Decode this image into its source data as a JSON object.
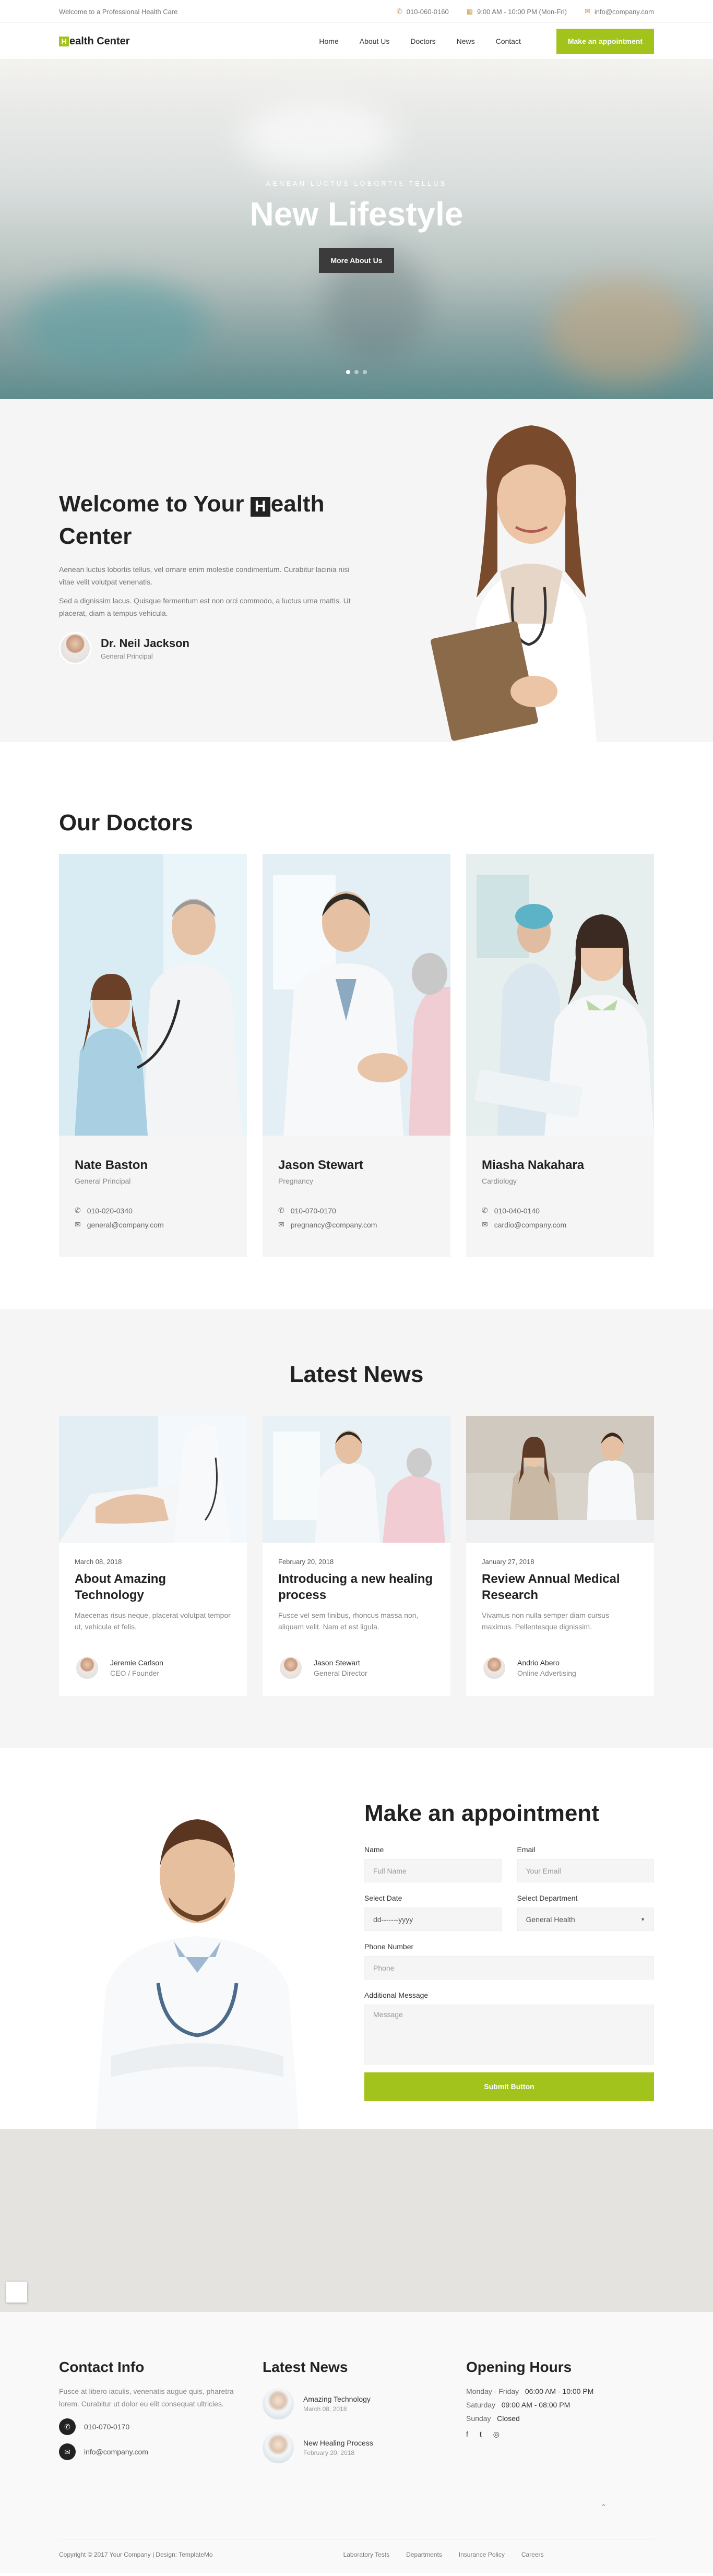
{
  "topbar": {
    "tagline": "Welcome to a Professional Health Care",
    "phone": "010-060-0160",
    "hours": "9:00 AM - 10:00 PM (Mon-Fri)",
    "email": "info@company.com"
  },
  "nav": {
    "logo_mark": "H",
    "logo_text": "ealth Center",
    "links": [
      "Home",
      "About Us",
      "Doctors",
      "News",
      "Contact"
    ],
    "cta": "Make an appointment"
  },
  "hero": {
    "subtitle": "AENEAN LUCTUS LOBORTIS TELLUS",
    "title": "New Lifestyle",
    "button": "More About Us",
    "slide_count": 3,
    "active_slide": 1
  },
  "welcome": {
    "title_before": "Welcome to Your ",
    "title_mark": "H",
    "title_after": "ealth Center",
    "paragraph1": "Aenean luctus lobortis tellus, vel ornare enim molestie condimentum. Curabitur lacinia nisi vitae velit volutpat venenatis.",
    "paragraph2": "Sed a dignissim lacus. Quisque fermentum est non orci commodo, a luctus urna mattis. Ut placerat, diam a tempus vehicula.",
    "author_name": "Dr. Neil Jackson",
    "author_role": "General Principal"
  },
  "doctors": {
    "title": "Our Doctors",
    "items": [
      {
        "name": "Nate Baston",
        "specialty": "General Principal",
        "phone": "010-020-0340",
        "email": "general@company.com"
      },
      {
        "name": "Jason Stewart",
        "specialty": "Pregnancy",
        "phone": "010-070-0170",
        "email": "pregnancy@company.com"
      },
      {
        "name": "Miasha Nakahara",
        "specialty": "Cardiology",
        "phone": "010-040-0140",
        "email": "cardio@company.com"
      }
    ]
  },
  "news": {
    "title": "Latest News",
    "items": [
      {
        "date": "March 08, 2018",
        "title": "About Amazing Technology",
        "text": "Maecenas risus neque, placerat volutpat tempor ut, vehicula et felis.",
        "author": "Jeremie Carlson",
        "role": "CEO / Founder"
      },
      {
        "date": "February 20, 2018",
        "title": "Introducing a new healing process",
        "text": "Fusce vel sem finibus, rhoncus massa non, aliquam velit. Nam et est ligula.",
        "author": "Jason Stewart",
        "role": "General Director"
      },
      {
        "date": "January 27, 2018",
        "title": "Review Annual Medical Research",
        "text": "Vivamus non nulla semper diam cursus maximus. Pellentesque dignissim.",
        "author": "Andrio Abero",
        "role": "Online Advertising"
      }
    ]
  },
  "appointment": {
    "title": "Make an appointment",
    "name_label": "Name",
    "name_placeholder": "Full Name",
    "email_label": "Email",
    "email_placeholder": "Your Email",
    "date_label": "Select Date",
    "date_placeholder": "dd-------yyyy",
    "dept_label": "Select Department",
    "dept_value": "General Health",
    "phone_label": "Phone Number",
    "phone_placeholder": "Phone",
    "msg_label": "Additional Message",
    "msg_placeholder": "Message",
    "submit": "Submit Button"
  },
  "footer": {
    "contact_title": "Contact Info",
    "contact_text": "Fusce at libero iaculis, venenatis augue quis, pharetra lorem. Curabitur ut dolor eu elit consequat ultricies.",
    "phone": "010-070-0170",
    "email": "info@company.com",
    "news_title": "Latest News",
    "news_items": [
      {
        "title": "Amazing Technology",
        "date": "March 08, 2018"
      },
      {
        "title": "New Healing Process",
        "date": "February 20, 2018"
      }
    ],
    "hours_title": "Opening Hours",
    "hours": [
      {
        "day": "Monday - Friday",
        "time": "06:00 AM - 10:00 PM"
      },
      {
        "day": "Saturday",
        "time": "09:00 AM - 08:00 PM"
      },
      {
        "day": "Sunday",
        "time": "Closed"
      }
    ],
    "copyright": "Copyright © 2017 Your Company | Design: TemplateMo",
    "links": [
      "Laboratory Tests",
      "Departments",
      "Insurance Policy",
      "Careers"
    ]
  }
}
